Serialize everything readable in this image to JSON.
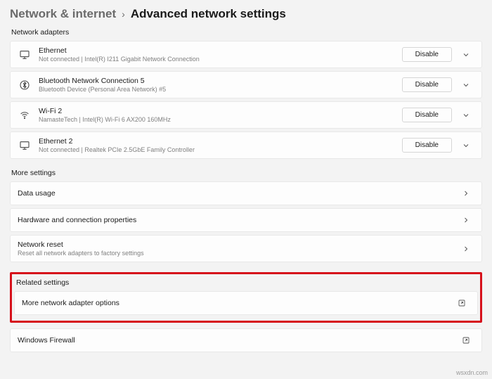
{
  "breadcrumb": {
    "parent": "Network & internet",
    "current": "Advanced network settings"
  },
  "sections": {
    "adapters_label": "Network adapters",
    "more_label": "More settings",
    "related_label": "Related settings"
  },
  "adapters": [
    {
      "name": "Ethernet",
      "detail": "Not connected | Intel(R) I211 Gigabit Network Connection",
      "action": "Disable"
    },
    {
      "name": "Bluetooth Network Connection 5",
      "detail": "Bluetooth Device (Personal Area Network) #5",
      "action": "Disable"
    },
    {
      "name": "Wi-Fi 2",
      "detail": "NamasteTech | Intel(R) Wi-Fi 6 AX200 160MHz",
      "action": "Disable"
    },
    {
      "name": "Ethernet 2",
      "detail": "Not connected | Realtek PCIe 2.5GbE Family Controller",
      "action": "Disable"
    }
  ],
  "more_settings": {
    "data_usage": "Data usage",
    "hw_props": "Hardware and connection properties",
    "reset_title": "Network reset",
    "reset_desc": "Reset all network adapters to factory settings"
  },
  "related": {
    "more_adapter": "More network adapter options",
    "firewall": "Windows Firewall"
  },
  "watermark": "wsxdn.com"
}
